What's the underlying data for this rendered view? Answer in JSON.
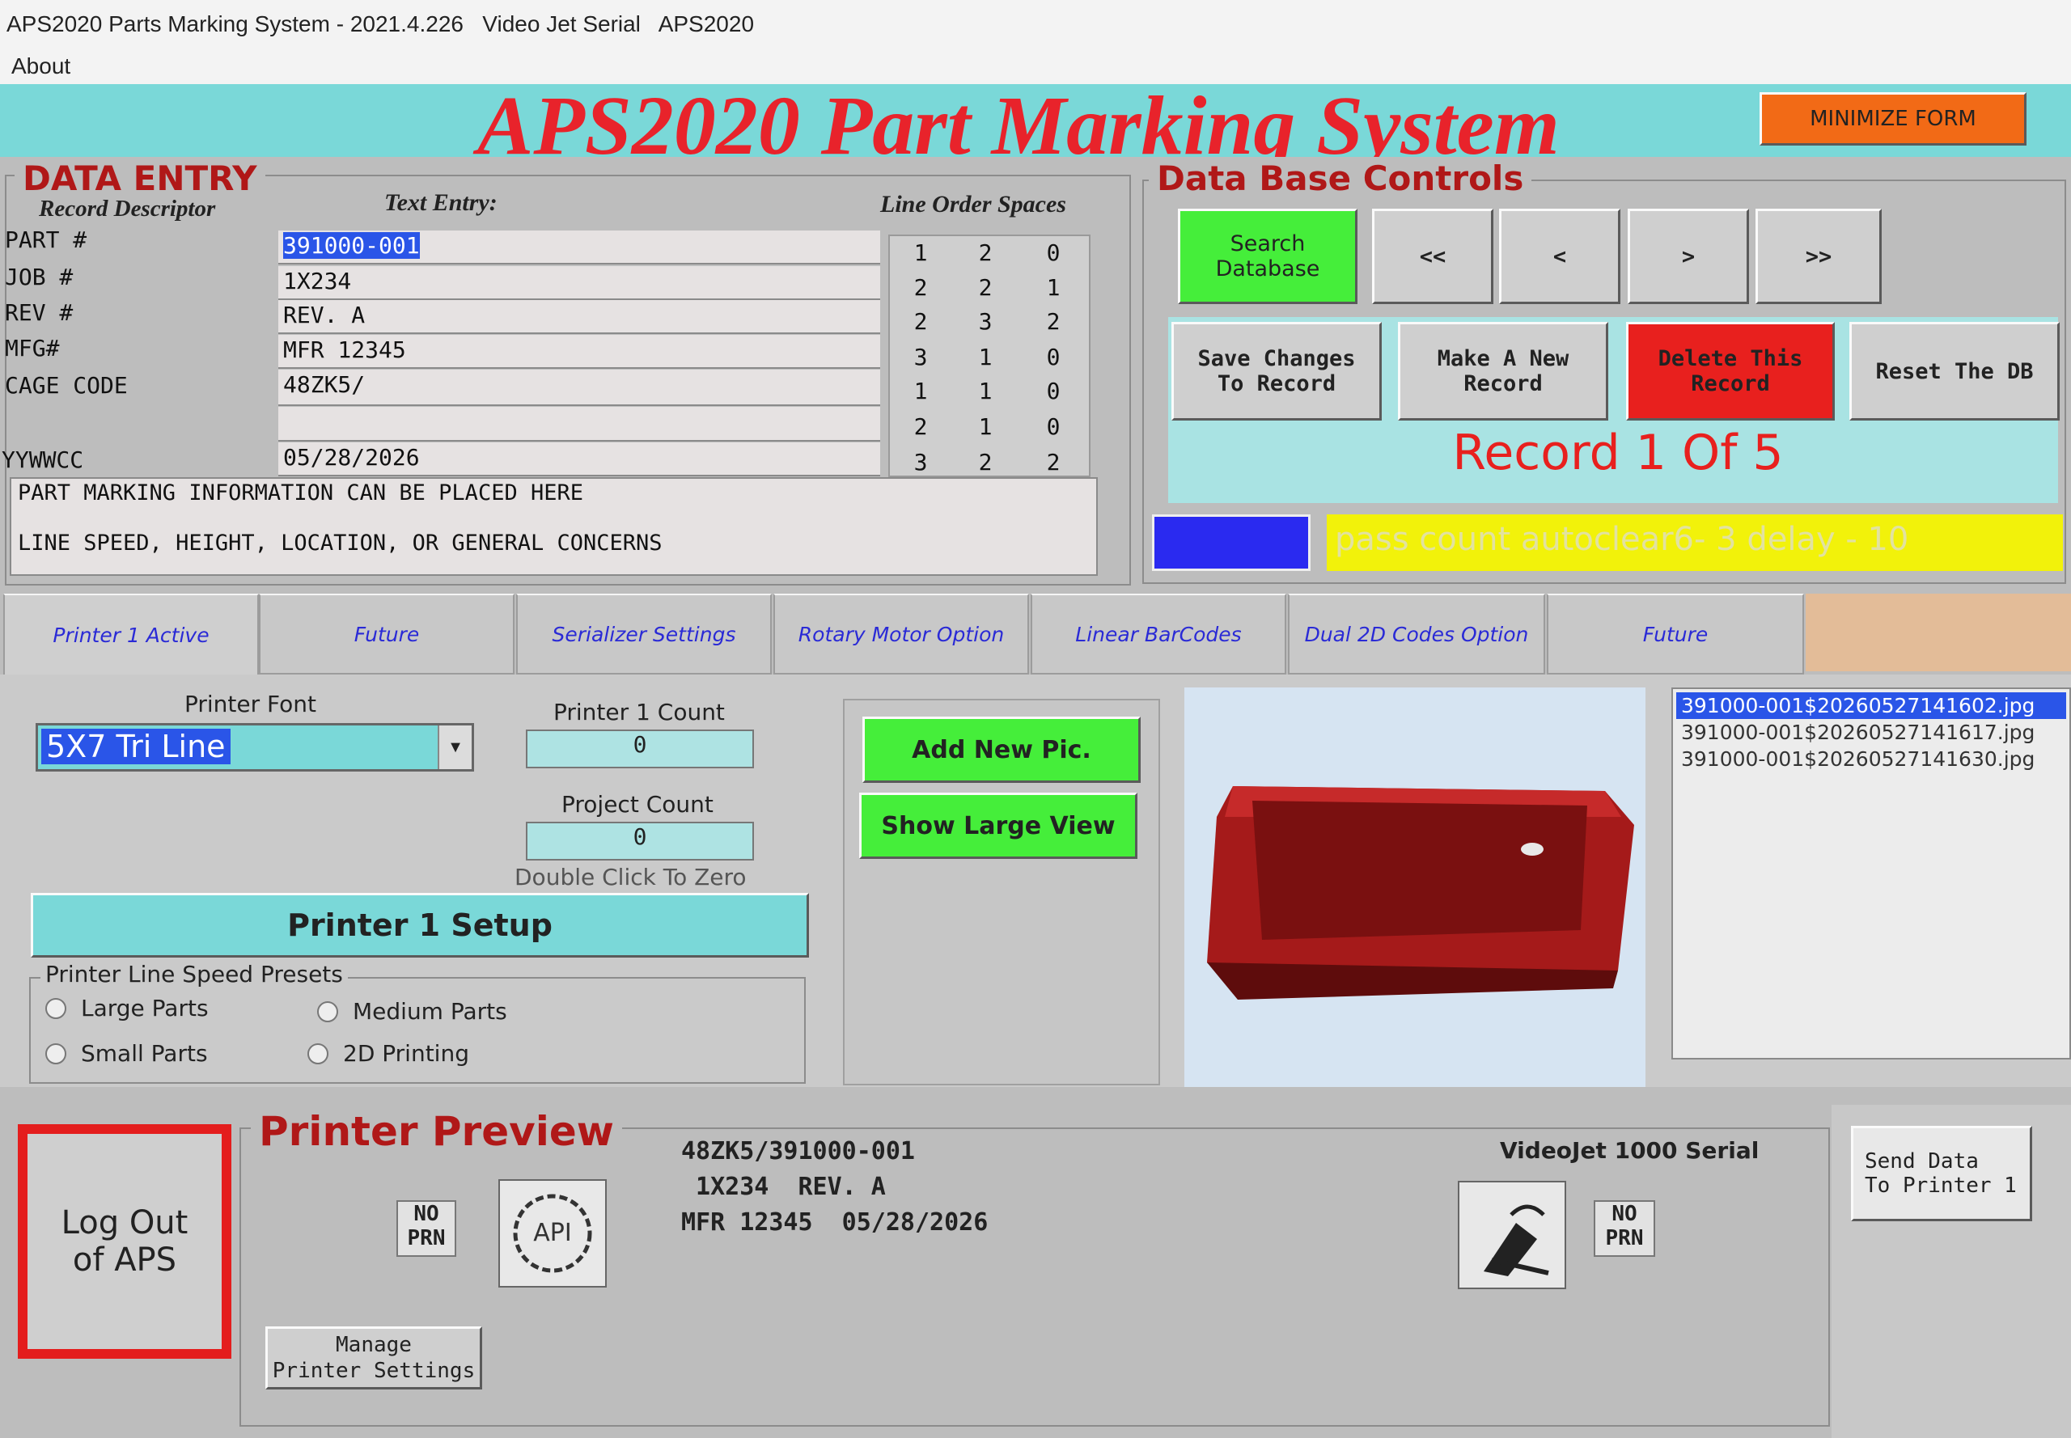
{
  "window": {
    "title": "APS2020 Parts Marking System - 2021.4.226   Video Jet Serial   APS2020",
    "menu_about": "About"
  },
  "banner": {
    "title": "APS2020 Part Marking System",
    "minimize_label": "MINIMIZE FORM"
  },
  "data_entry": {
    "heading": "DATA ENTRY",
    "record_descriptor": "Record Descriptor",
    "text_entry": "Text Entry:",
    "line_order_spaces": "Line Order Spaces",
    "rows": [
      {
        "label": "PART #",
        "value": "391000-001",
        "order": [
          "1",
          "2",
          "0"
        ]
      },
      {
        "label": "JOB #",
        "value": "1X234",
        "order": [
          "2",
          "2",
          "1"
        ]
      },
      {
        "label": "REV #",
        "value": "REV. A",
        "order": [
          "2",
          "3",
          "2"
        ]
      },
      {
        "label": "MFG#",
        "value": "MFR 12345",
        "order": [
          "3",
          "1",
          "0"
        ]
      },
      {
        "label": "CAGE CODE",
        "value": "48ZK5/",
        "order": [
          "1",
          "1",
          "0"
        ]
      },
      {
        "label": "",
        "value": "",
        "order": [
          "2",
          "1",
          "0"
        ]
      },
      {
        "label": "YYWWCC",
        "value": "05/28/2026",
        "order": [
          "3",
          "2",
          "2"
        ]
      }
    ],
    "notes_line1": "PART MARKING INFORMATION CAN BE PLACED HERE",
    "notes_line2": "LINE SPEED, HEIGHT, LOCATION, OR GENERAL CONCERNS"
  },
  "db_controls": {
    "heading": "Data Base Controls",
    "search_label": "Search\nDatabase",
    "first": "<<",
    "prev": "<",
    "next": ">",
    "last": ">>",
    "save_label": "Save Changes\nTo Record",
    "new_label": "Make A New\nRecord",
    "delete_label": "Delete This\nRecord",
    "reset_label": "Reset The DB",
    "record_status": "Record 1 Of 5",
    "status_text": "pass count autoclear6- 3  delay - 10"
  },
  "tabs": [
    {
      "label": "Printer 1 Active"
    },
    {
      "label": "Future"
    },
    {
      "label": "Serializer Settings"
    },
    {
      "label": "Rotary Motor Option"
    },
    {
      "label": "Linear BarCodes"
    },
    {
      "label": "Dual 2D Codes Option"
    },
    {
      "label": "Future"
    }
  ],
  "printer": {
    "font_label": "Printer Font",
    "font_value": "5X7 Tri Line",
    "count_label": "Printer 1 Count",
    "count_value": "0",
    "project_label": "Project Count",
    "project_value": "0",
    "zero_hint": "Double Click To Zero",
    "setup_label": "Printer 1 Setup",
    "presets_title": "Printer Line Speed Presets",
    "presets": [
      "Large Parts",
      "Medium Parts",
      "Small Parts",
      "2D Printing"
    ],
    "add_pic": "Add New Pic.",
    "large_view": "Show Large View",
    "files": [
      "391000-001$20260527141602.jpg",
      "391000-001$20260527141617.jpg",
      "391000-001$20260527141630.jpg"
    ]
  },
  "preview": {
    "logout_label": "Log Out\nof APS",
    "heading": "Printer Preview",
    "no_prn": "NO\nPRN",
    "line1": "48ZK5/391000-001",
    "line2": " 1X234  REV. A",
    "line3": "MFR 12345  05/28/2026",
    "printer_model": "VideoJet 1000 Serial",
    "no_prn2": "NO\nPRN",
    "send_label": "Send Data\nTo Printer 1",
    "manage_label": "Manage\nPrinter Settings"
  },
  "colors": {
    "banner_bg": "#7ad8d8",
    "title_red": "#e8232b",
    "minimize_orange": "#f26a16",
    "green": "#45ee3a",
    "delete_red": "#e8201e",
    "status_yellow": "#f2f20a",
    "indicator_blue": "#2a2af0",
    "tab_text_blue": "#2a2ad6"
  }
}
